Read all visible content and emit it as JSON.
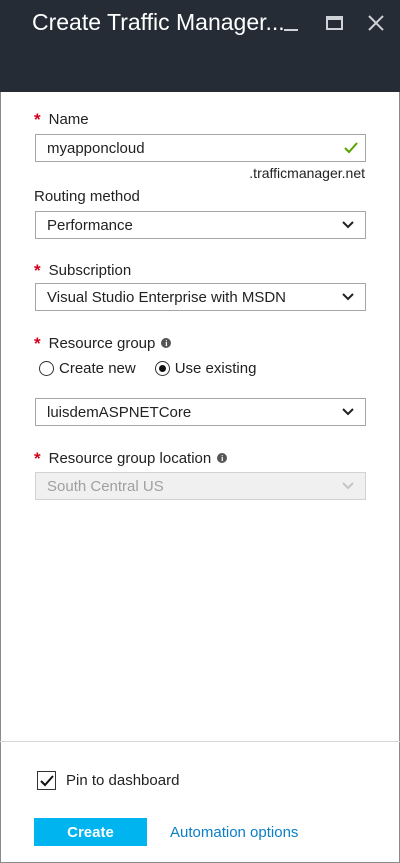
{
  "header": {
    "title": "Create Traffic Manager..."
  },
  "form": {
    "name": {
      "label": "Name",
      "required_mark": "*",
      "value": "myapponcloud",
      "suffix": ".trafficmanager.net",
      "status_icon": "check-icon",
      "status_color": "#57a300"
    },
    "routing_method": {
      "label": "Routing method",
      "value": "Performance"
    },
    "subscription": {
      "label": "Subscription",
      "required_mark": "*",
      "value": "Visual Studio Enterprise with MSDN"
    },
    "resource_group": {
      "label": "Resource group",
      "required_mark": "*",
      "info_icon": "i",
      "options": [
        "Create new",
        "Use existing"
      ],
      "selected_option": "Use existing",
      "value": "luisdemASPNETCore"
    },
    "resource_group_location": {
      "label": "Resource group location",
      "required_mark": "*",
      "info_icon": "i",
      "value": "South Central US",
      "disabled": true
    }
  },
  "footer": {
    "pin_label": "Pin to dashboard",
    "pin_checked": true,
    "create_label": "Create",
    "automation_label": "Automation options"
  },
  "colors": {
    "header_bg": "#252c36",
    "required": "#d0021b",
    "primary_button": "#00b4f0",
    "link": "#0a7fc8"
  }
}
